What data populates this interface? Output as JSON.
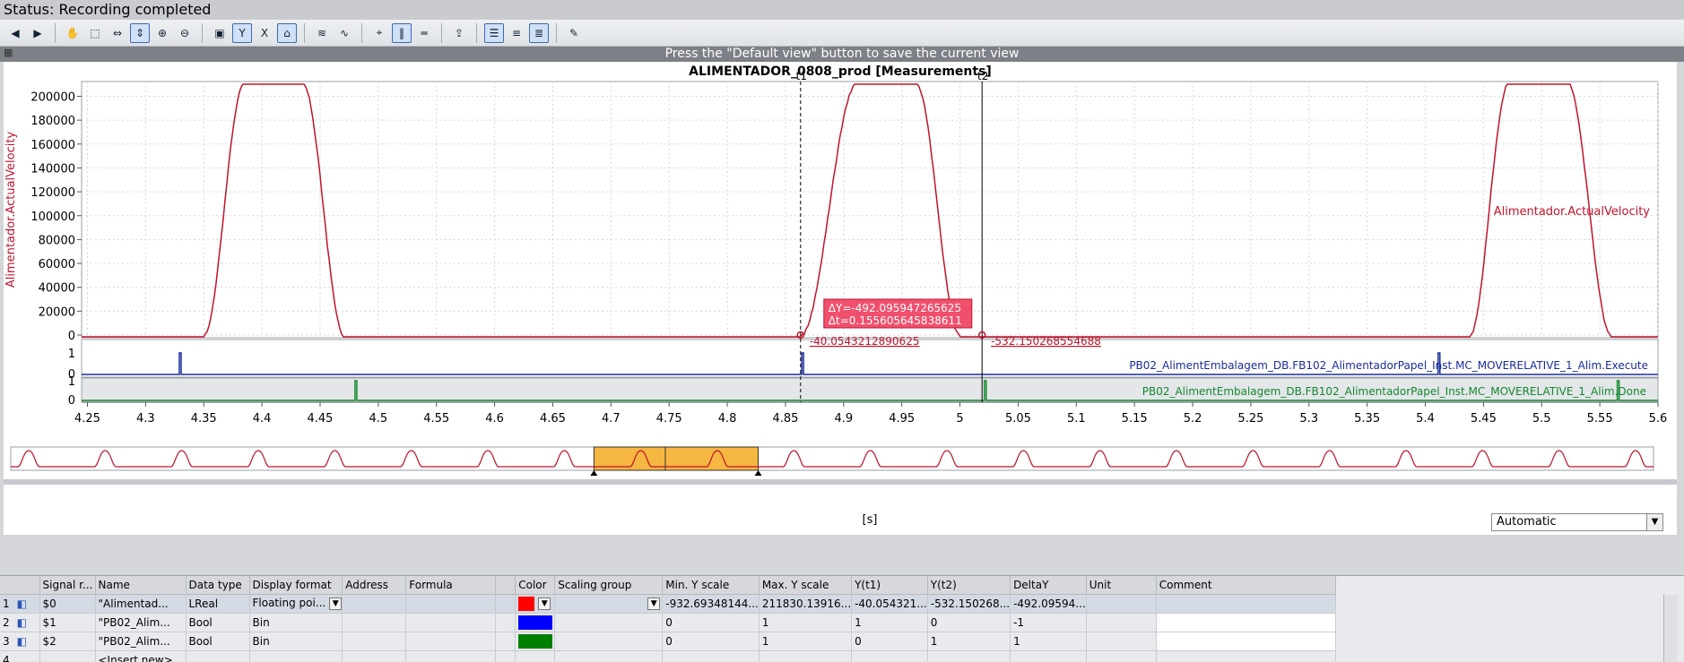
{
  "status": {
    "text": "Status: Recording completed"
  },
  "toolbar": {
    "buttons": [
      "back-icon",
      "forward-icon",
      "pan-hand-icon",
      "zoom-box-icon",
      "zoom-x-icon",
      "zoom-y-icon",
      "zoom-in-icon",
      "zoom-out-icon",
      "zoom-100-icon",
      "zoom-y-100-icon",
      "zoom-x-100-icon",
      "default-view-icon",
      "signal-arrange-icon",
      "curve-icon",
      "measure-cursor-icon",
      "vertical-cursor-icon",
      "horizontal-cursor-icon",
      "export-icon",
      "legend-icon",
      "align-left-icon",
      "align-right-icon",
      "clear-icon"
    ]
  },
  "banner": "Press the \"Default view\" button to save the current view",
  "chart_data": {
    "type": "line",
    "title": "ALIMENTADOR_0808_prod [Measurements]",
    "xlabel": "[s]",
    "ylabel": "Alimentador.ActualVelocity",
    "xlim": [
      4.245,
      5.6
    ],
    "x_ticks": [
      "4.25",
      "4.3",
      "4.35",
      "4.4",
      "4.45",
      "4.5",
      "4.55",
      "4.6",
      "4.65",
      "4.7",
      "4.75",
      "4.8",
      "4.85",
      "4.9",
      "4.95",
      "5",
      "5.05",
      "5.1",
      "5.15",
      "5.2",
      "5.25",
      "5.3",
      "5.35",
      "5.4",
      "5.45",
      "5.5",
      "5.55",
      "5.6"
    ],
    "ylim": [
      -5000,
      215000
    ],
    "y_ticks": [
      "200000",
      "180000",
      "160000",
      "140000",
      "120000",
      "100000",
      "80000",
      "60000",
      "40000",
      "20000",
      "0"
    ],
    "series": [
      {
        "name": "Alimentador.ActualVelocity",
        "color": "#c0142c",
        "pulses": [
          {
            "rise_start": 4.35,
            "plateau_start": 4.385,
            "plateau_end": 4.435,
            "fall_end": 4.471
          },
          {
            "rise_start": 4.863,
            "plateau_start": 4.912,
            "plateau_end": 4.962,
            "fall_end": 5.0
          },
          {
            "rise_start": 5.438,
            "plateau_start": 5.472,
            "plateau_end": 5.522,
            "fall_end": 5.56
          }
        ],
        "peak": 212000
      },
      {
        "name": "PB02_AlimentEmbalagem_DB.FB102_AlimentadorPapel_Inst.MC_MOVERELATIVE_1_Alim.Execute",
        "color": "#1a2c9e",
        "ylim": [
          0,
          1
        ],
        "y_ticks": [
          "1",
          "0"
        ],
        "high_at": [
          4.329,
          4.864,
          5.411
        ]
      },
      {
        "name": "PB02_AlimentEmbalagem_DB.FB102_AlimentadorPapel_Inst.MC_MOVERELATIVE_1_Alim.Done",
        "color": "#128a2a",
        "ylim": [
          0,
          1
        ],
        "y_ticks": [
          "1",
          "0"
        ],
        "high_at": [
          4.48,
          5.021,
          5.565
        ]
      }
    ],
    "cursors": [
      {
        "label": "t1",
        "x": 4.863,
        "value": "-40.0543212890625"
      },
      {
        "label": "t2",
        "x": 5.019,
        "value": "-532.150268554688"
      }
    ],
    "delta_box": {
      "dy": "ΔY=-492.095947265625",
      "dt": "Δt=0.155605645838611"
    },
    "overview_pulses": 22,
    "overview_window": [
      0.355,
      0.455
    ]
  },
  "scale_select": {
    "value": "Automatic"
  },
  "table": {
    "headers": [
      "Signal r...",
      "Name",
      "Data type",
      "Display format",
      "Address",
      "Formula",
      "",
      "Color",
      "Scaling group",
      "Min. Y scale",
      "Max. Y scale",
      "Y(t1)",
      "Y(t2)",
      "DeltaY",
      "Unit",
      "Comment"
    ],
    "rows": [
      {
        "num": "1",
        "signal": "$0",
        "name": "\"Alimentad...",
        "dtype": "LReal",
        "format": "Floating poi...",
        "color": "#ff0000",
        "min": "-932.69348144...",
        "max": "211830.13916...",
        "yt1": "-40.054321...",
        "yt2": "-532.150268...",
        "delta": "-492.09594..."
      },
      {
        "num": "2",
        "signal": "$1",
        "name": "\"PB02_Alim...",
        "dtype": "Bool",
        "format": "Bin",
        "color": "#0000ff",
        "min": "0",
        "max": "1",
        "yt1": "1",
        "yt2": "0",
        "delta": "-1"
      },
      {
        "num": "3",
        "signal": "$2",
        "name": "\"PB02_Alim...",
        "dtype": "Bool",
        "format": "Bin",
        "color": "#008000",
        "min": "0",
        "max": "1",
        "yt1": "0",
        "yt2": "1",
        "delta": "1"
      },
      {
        "num": "4",
        "signal": "",
        "name": "<Insert new>",
        "dtype": "",
        "format": "",
        "color": "",
        "min": "",
        "max": "",
        "yt1": "",
        "yt2": "",
        "delta": ""
      }
    ]
  }
}
